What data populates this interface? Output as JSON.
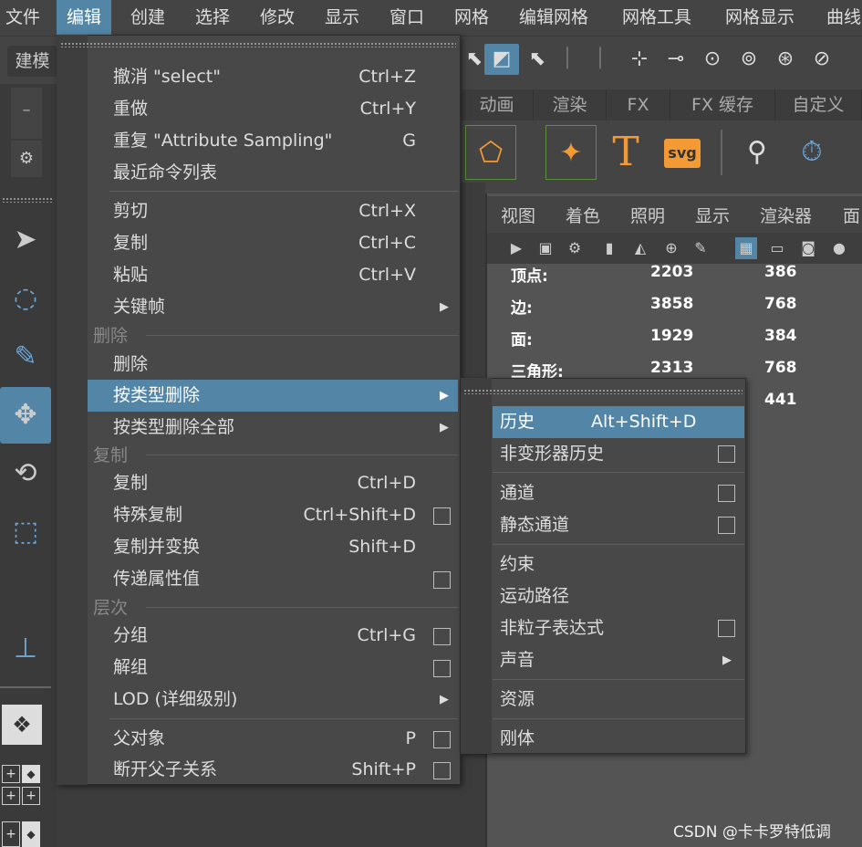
{
  "menubar": {
    "items": [
      "文件",
      "编辑",
      "创建",
      "选择",
      "修改",
      "显示",
      "窗口",
      "网格",
      "编辑网格",
      "网格工具",
      "网格显示",
      "曲线"
    ],
    "active": "编辑"
  },
  "toolbar": {
    "mode_label": "建模"
  },
  "shelf": {
    "tabs": [
      "动画",
      "渲染",
      "FX",
      "FX 缓存",
      "自定义"
    ],
    "text_icon": "T",
    "svg_icon": "svg"
  },
  "viewport": {
    "menus": [
      "视图",
      "着色",
      "照明",
      "显示",
      "渲染器",
      "面"
    ],
    "hud": [
      {
        "label": "顶点:",
        "v1": "2203",
        "v2": "386"
      },
      {
        "label": "边:",
        "v1": "3858",
        "v2": "768"
      },
      {
        "label": "面:",
        "v1": "1929",
        "v2": "384"
      },
      {
        "label": "三角形:",
        "v1": "2313",
        "v2": "768"
      },
      {
        "label": "",
        "v1": "",
        "v2": "441"
      }
    ]
  },
  "edit_menu": {
    "items": [
      {
        "label": "撤消 \"select\"",
        "shortcut": "Ctrl+Z"
      },
      {
        "label": "重做",
        "shortcut": "Ctrl+Y"
      },
      {
        "label": "重复 \"Attribute Sampling\"",
        "shortcut": "G"
      },
      {
        "label": "最近命令列表",
        "shortcut": ""
      },
      {
        "label": "剪切",
        "shortcut": "Ctrl+X"
      },
      {
        "label": "复制",
        "shortcut": "Ctrl+C"
      },
      {
        "label": "粘贴",
        "shortcut": "Ctrl+V"
      },
      {
        "label": "关键帧",
        "shortcut": ""
      },
      {
        "label": "删除",
        "shortcut": ""
      },
      {
        "label": "按类型删除",
        "shortcut": ""
      },
      {
        "label": "按类型删除全部",
        "shortcut": ""
      },
      {
        "label": "复制",
        "shortcut": "Ctrl+D"
      },
      {
        "label": "特殊复制",
        "shortcut": "Ctrl+Shift+D"
      },
      {
        "label": "复制并变换",
        "shortcut": "Shift+D"
      },
      {
        "label": "传递属性值",
        "shortcut": ""
      },
      {
        "label": "分组",
        "shortcut": "Ctrl+G"
      },
      {
        "label": "解组",
        "shortcut": ""
      },
      {
        "label": "LOD (详细级别)",
        "shortcut": ""
      },
      {
        "label": "父对象",
        "shortcut": "P"
      },
      {
        "label": "断开父子关系",
        "shortcut": "Shift+P"
      }
    ],
    "sections": [
      "删除",
      "复制",
      "层次"
    ]
  },
  "submenu": {
    "items": [
      {
        "label": "历史",
        "shortcut": "Alt+Shift+D"
      },
      {
        "label": "非变形器历史",
        "shortcut": ""
      },
      {
        "label": "通道",
        "shortcut": ""
      },
      {
        "label": "静态通道",
        "shortcut": ""
      },
      {
        "label": "约束",
        "shortcut": ""
      },
      {
        "label": "运动路径",
        "shortcut": ""
      },
      {
        "label": "非粒子表达式",
        "shortcut": ""
      },
      {
        "label": "声音",
        "shortcut": ""
      },
      {
        "label": "资源",
        "shortcut": ""
      },
      {
        "label": "刚体",
        "shortcut": ""
      }
    ]
  },
  "watermark": "CSDN @卡卡罗特低调",
  "colors": {
    "accent": "#5285a6",
    "menu_bg": "#484848",
    "orange": "#f39a35"
  }
}
